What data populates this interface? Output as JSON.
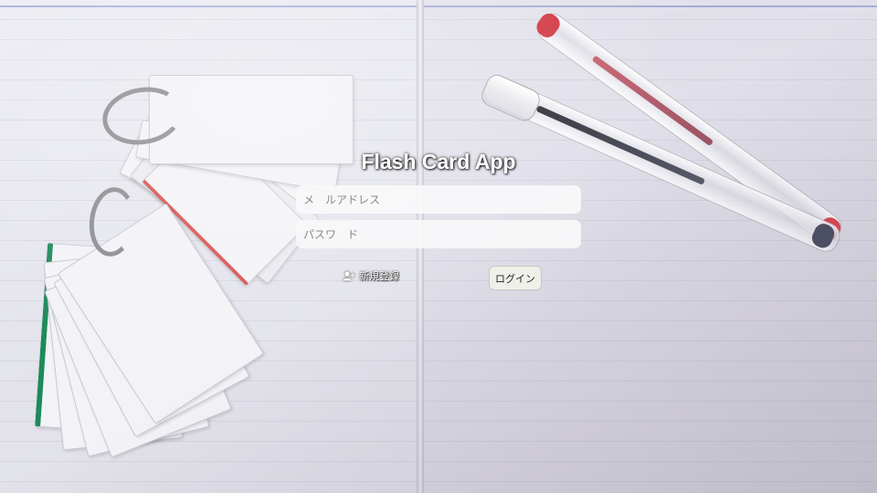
{
  "app": {
    "title": "Flash Card App"
  },
  "form": {
    "email": {
      "placeholder": "メ　ルアドレス",
      "value": ""
    },
    "password": {
      "placeholder": "パスワ　ド",
      "value": ""
    },
    "register_label": "新規登録",
    "login_label": "ログイン"
  },
  "icons": {
    "register": "user-plus-icon"
  },
  "colors": {
    "title_text": "#ffffff",
    "field_bg": "#f8f8fa",
    "button_bg": "#eef0ea"
  }
}
